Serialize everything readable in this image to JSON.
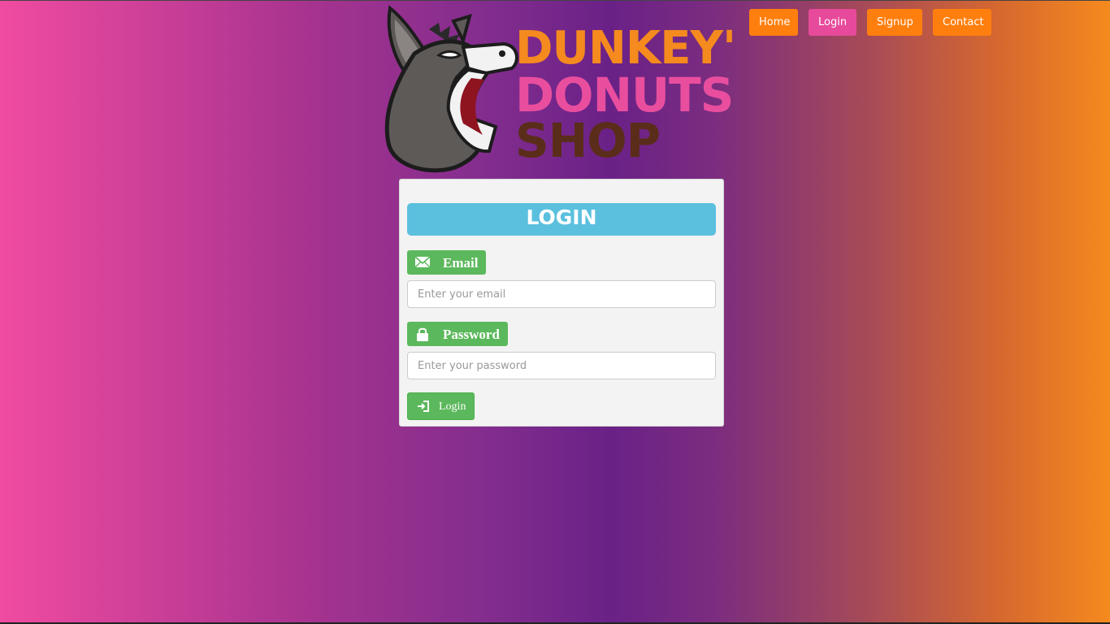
{
  "nav": {
    "items": [
      {
        "label": "Home",
        "color": "#ff7f0e"
      },
      {
        "label": "Login",
        "color": "#e84a9b"
      },
      {
        "label": "Signup",
        "color": "#ff7f0e"
      },
      {
        "label": "Contact",
        "color": "#ff7f0e"
      }
    ]
  },
  "logo": {
    "line1": "DUNKEY'",
    "line2": "DONUTS",
    "line3": "SHOP",
    "colors": {
      "line1": "#f58a1e",
      "line2": "#e94e9e",
      "line3": "#5a2d1a",
      "donkey": "#5e5a58"
    }
  },
  "login_form": {
    "title": "LOGIN",
    "email": {
      "label": "Email",
      "icon": "envelope-icon",
      "placeholder": "Enter your email",
      "value": ""
    },
    "password": {
      "label": "Password",
      "icon": "lock-icon",
      "placeholder": "Enter your password",
      "value": ""
    },
    "submit": {
      "label": "Login",
      "icon": "log-in-icon"
    }
  },
  "colors": {
    "title_bar": "#5bc0de",
    "success_green": "#5cb85c",
    "card_bg": "#f3f3f3"
  }
}
